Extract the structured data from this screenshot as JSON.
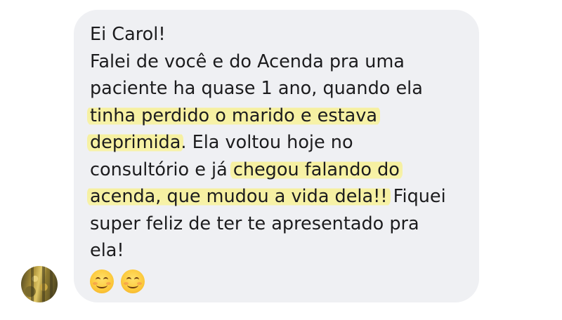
{
  "message": {
    "lines": [
      {
        "before": "Ei Carol!",
        "highlight": "",
        "after": ""
      },
      {
        "before": "Falei de você e do Acenda pra uma",
        "highlight": "",
        "after": ""
      },
      {
        "before": "paciente ha quase 1 ano, quando ela",
        "highlight": "",
        "after": ""
      },
      {
        "before": "",
        "highlight": "tinha perdido o marido e estava",
        "after": ""
      },
      {
        "before": "",
        "highlight": "deprimida",
        "after": ". Ela voltou hoje no"
      },
      {
        "before": "consultório e já ",
        "highlight": "chegou falando do",
        "after": ""
      },
      {
        "before": "",
        "highlight": "acenda, que mudou a vida dela!!",
        "after": " Fiquei"
      },
      {
        "before": "super feliz de ter te apresentado pra",
        "highlight": "",
        "after": ""
      },
      {
        "before": "ela!",
        "highlight": "",
        "after": ""
      }
    ],
    "emoji_count": 2,
    "emoji_names": [
      "smiling-face-icon",
      "smiling-face-icon"
    ]
  },
  "colors": {
    "bubble": "#eff0f3",
    "highlight": "#f7f2a8",
    "text": "#1c1c1e"
  }
}
